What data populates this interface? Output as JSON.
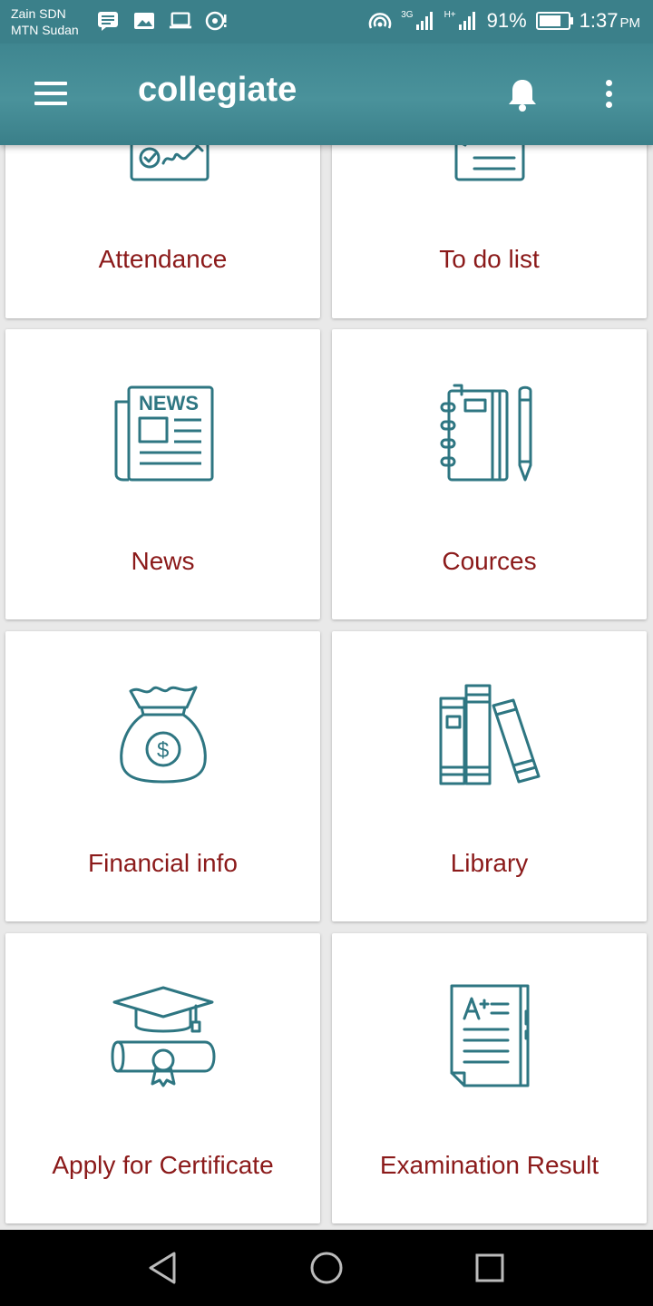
{
  "status_bar": {
    "carrier1": "Zain SDN",
    "carrier2": "MTN Sudan",
    "network_1": "3G",
    "network_2": "H+",
    "battery": "91%",
    "battery_level": 0.91,
    "time": "1:37",
    "ampm": "PM"
  },
  "app_bar": {
    "title": "collegiate",
    "menu_icon": "hamburger-icon",
    "notification_icon": "bell-icon",
    "overflow_icon": "more-vert-icon"
  },
  "tiles": [
    {
      "label": "Attendance",
      "icon": "attendance-icon"
    },
    {
      "label": "To do list",
      "icon": "todo-icon"
    },
    {
      "label": "News",
      "icon": "newspaper-icon"
    },
    {
      "label": "Cources",
      "icon": "notebook-icon"
    },
    {
      "label": "Financial info",
      "icon": "money-bag-icon"
    },
    {
      "label": "Library",
      "icon": "books-icon"
    },
    {
      "label": "Apply for Certificate",
      "icon": "graduation-icon"
    },
    {
      "label": "Examination Result",
      "icon": "exam-result-icon"
    }
  ],
  "nav_bar": {
    "back": "back-icon",
    "home": "home-icon",
    "recents": "recents-icon"
  },
  "colors": {
    "primary": "#3b808a",
    "icon": "#2e7682",
    "label": "#8b1a1a",
    "background": "#e9e9e9"
  }
}
